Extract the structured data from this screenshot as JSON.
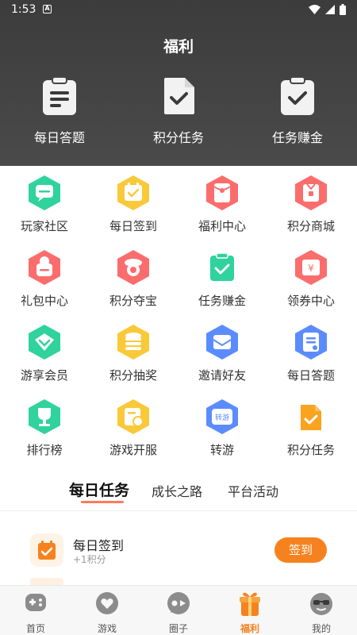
{
  "status_bar": {
    "time": "1:53",
    "a_icon": "A"
  },
  "header": {
    "title": "福利",
    "features": [
      {
        "label": "每日答题",
        "icon": "clipboard-list-icon"
      },
      {
        "label": "积分任务",
        "icon": "document-check-icon"
      },
      {
        "label": "任务赚金",
        "icon": "clipboard-check-icon"
      }
    ]
  },
  "grid": {
    "items": [
      {
        "label": "玩家社区",
        "icon": "chat-icon",
        "color": "#2fd39b"
      },
      {
        "label": "每日签到",
        "icon": "calendar-check-icon",
        "color": "#f9c93a"
      },
      {
        "label": "福利中心",
        "icon": "red-envelope-icon",
        "color": "#fb6d6d"
      },
      {
        "label": "积分商城",
        "icon": "gift-box-icon",
        "color": "#fb6d6d"
      },
      {
        "label": "礼包中心",
        "icon": "gift-bag-icon",
        "color": "#fb6d6d"
      },
      {
        "label": "积分夺宝",
        "icon": "treasure-icon",
        "color": "#fb6d6d"
      },
      {
        "label": "任务赚金",
        "icon": "task-check-icon",
        "color": "#2fd39b"
      },
      {
        "label": "领券中心",
        "icon": "coupon-icon",
        "color": "#fb6d6d"
      },
      {
        "label": "游享会员",
        "icon": "vip-heart-icon",
        "color": "#2fd39b"
      },
      {
        "label": "积分抽奖",
        "icon": "coin-stack-icon",
        "color": "#f9c93a"
      },
      {
        "label": "邀请好友",
        "icon": "invite-mail-icon",
        "color": "#5b8cff"
      },
      {
        "label": "每日答题",
        "icon": "quiz-doc-icon",
        "color": "#5b8cff"
      },
      {
        "label": "排行榜",
        "icon": "trophy-icon",
        "color": "#2fd39b"
      },
      {
        "label": "游戏开服",
        "icon": "schedule-icon",
        "color": "#f9c93a"
      },
      {
        "label": "转游",
        "icon": "transfer-game-icon",
        "color": "#5b8cff",
        "badge": "转游"
      },
      {
        "label": "积分任务",
        "icon": "points-task-icon",
        "color": "#f9a31f"
      }
    ]
  },
  "tabs": [
    {
      "label": "每日任务",
      "active": true
    },
    {
      "label": "成长之路",
      "active": false
    },
    {
      "label": "平台活动",
      "active": false
    }
  ],
  "tasks": [
    {
      "title": "每日签到",
      "reward": "+1积分",
      "button": "签到"
    }
  ],
  "bottom_nav": [
    {
      "label": "首页",
      "icon": "gamepad-icon",
      "active": false
    },
    {
      "label": "游戏",
      "icon": "heart-bubble-icon",
      "active": false
    },
    {
      "label": "圈子",
      "icon": "circle-chat-icon",
      "active": false
    },
    {
      "label": "福利",
      "icon": "gift-icon",
      "active": true
    },
    {
      "label": "我的",
      "icon": "sunglasses-face-icon",
      "active": false
    }
  ],
  "colors": {
    "accent": "#f6821f",
    "header_bg": "#454545",
    "tab_underline": "#ff7a5a"
  }
}
